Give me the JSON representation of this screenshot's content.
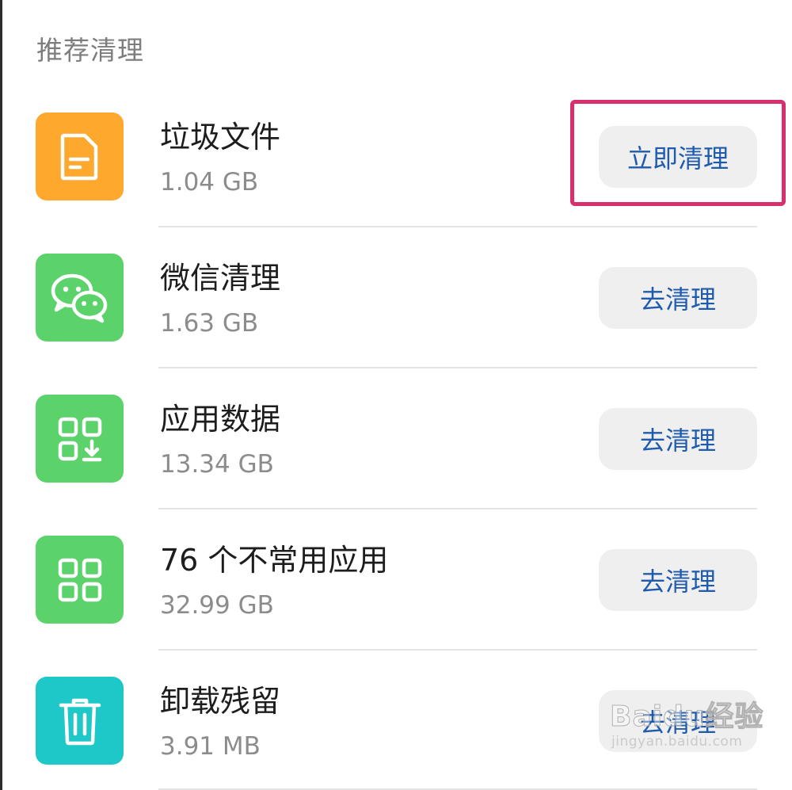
{
  "section": {
    "title": "推荐清理"
  },
  "items": [
    {
      "icon": "document-icon",
      "icon_color": "#FFA82E",
      "title": "垃圾文件",
      "size": "1.04 GB",
      "button": "立即清理"
    },
    {
      "icon": "wechat-icon",
      "icon_color": "#5BD26A",
      "title": "微信清理",
      "size": "1.63 GB",
      "button": "去清理"
    },
    {
      "icon": "app-data-icon",
      "icon_color": "#5BD26A",
      "title": "应用数据",
      "size": "13.34 GB",
      "button": "去清理"
    },
    {
      "icon": "apps-grid-icon",
      "icon_color": "#5BD26A",
      "title": "76 个不常用应用",
      "size": "32.99 GB",
      "button": "去清理"
    },
    {
      "icon": "trash-icon",
      "icon_color": "#1FC8C8",
      "title": "卸载残留",
      "size": "3.91 MB",
      "button": "去清理"
    }
  ],
  "colors": {
    "button_text": "#1F5BAD",
    "button_bg": "#EFEFEF",
    "highlight": "#D8306E"
  },
  "watermark": {
    "brand": "Baidu经验",
    "url": "jingyan.baidu.com"
  }
}
